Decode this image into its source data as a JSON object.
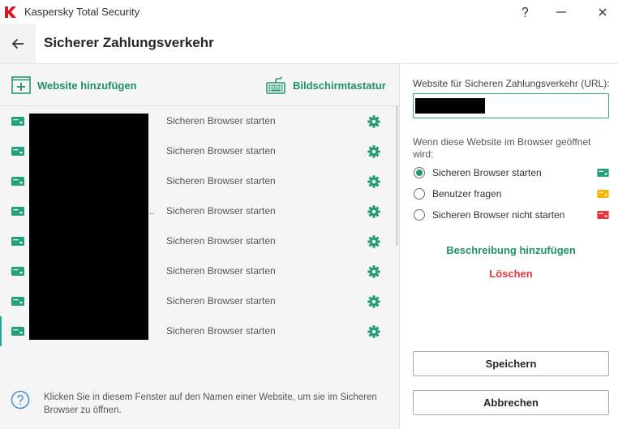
{
  "window": {
    "title": "Kaspersky Total Security",
    "logo_icon": "kaspersky-logo",
    "control_icons": [
      "help-icon",
      "minimize-icon",
      "close-icon"
    ]
  },
  "header": {
    "back_icon": "arrow-left-icon",
    "title": "Sicherer Zahlungsverkehr"
  },
  "toolbar": {
    "add_website_icon": "add-box-icon",
    "add_website_label": "Website hinzufügen",
    "keyboard_icon": "keyboard-icon",
    "keyboard_label": "Bildschirmtastatur"
  },
  "sites": [
    {
      "action": "Sicheren Browser starten",
      "status_color": "#24a07a"
    },
    {
      "action": "Sicheren Browser starten",
      "status_color": "#24a07a"
    },
    {
      "action": "Sicheren Browser starten",
      "status_color": "#24a07a"
    },
    {
      "action": "Sicheren Browser starten",
      "status_color": "#24a07a",
      "name_tail": ".."
    },
    {
      "action": "Sicheren Browser starten",
      "status_color": "#24a07a"
    },
    {
      "action": "Sicheren Browser starten",
      "status_color": "#24a07a"
    },
    {
      "action": "Sicheren Browser starten",
      "status_color": "#24a07a"
    },
    {
      "action": "Sicheren Browser starten",
      "status_color": "#24a07a",
      "selected": true
    }
  ],
  "help": {
    "icon": "question-circle-icon",
    "text": "Klicken Sie in diesem Fenster auf den Namen einer Website, um sie im Sicheren Browser zu öffnen."
  },
  "details": {
    "url_label": "Website für Sicheren Zahlungsverkehr (URL):",
    "behavior_label": "Wenn diese Website im Browser geöffnet wird:",
    "options": [
      {
        "label": "Sicheren Browser starten",
        "selected": true,
        "icon_color": "#24a07a"
      },
      {
        "label": "Benutzer fragen",
        "selected": false,
        "icon_color": "#f6b500"
      },
      {
        "label": "Sicheren Browser nicht starten",
        "selected": false,
        "icon_color": "#e8383d"
      }
    ],
    "add_description": "Beschreibung hinzufügen",
    "delete": "Löschen",
    "save": "Speichern",
    "cancel": "Abbrechen"
  },
  "colors": {
    "accent": "#1f8f6d",
    "gear": "#1f9a75",
    "danger": "#e2383f",
    "input_border": "#35a38a",
    "selection": "#2aa39a",
    "help_icon": "#4a8fc6",
    "logo": "#d6191f"
  }
}
